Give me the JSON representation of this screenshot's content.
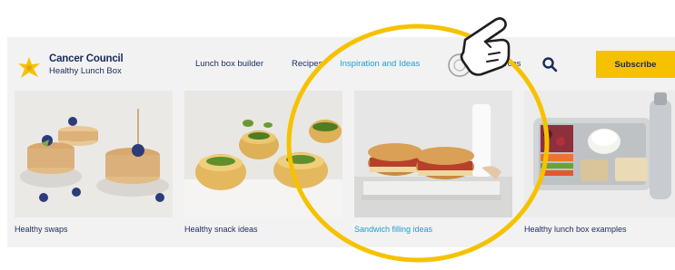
{
  "brand": {
    "name": "Cancer Council",
    "subtitle": "Healthy Lunch Box"
  },
  "nav": {
    "items": [
      {
        "label": "Lunch box builder"
      },
      {
        "label": "Recipes"
      },
      {
        "label": "Inspiration and Ideas"
      },
      {
        "label": "Resources"
      }
    ],
    "subscribe_label": "Subscribe"
  },
  "cards": [
    {
      "label": "Healthy swaps"
    },
    {
      "label": "Healthy snack ideas"
    },
    {
      "label": "Sandwich filling ideas"
    },
    {
      "label": "Healthy lunch box examples"
    }
  ],
  "colors": {
    "navy": "#1a2a5e",
    "accent_blue": "#1a9fd0",
    "yellow": "#f6c200",
    "panel_gray": "#f2f2f2"
  },
  "icons": {
    "logo": "cancer-council-daffodil-icon",
    "search": "search-icon",
    "hand": "pointing-hand-icon",
    "highlight": "highlight-circle"
  }
}
